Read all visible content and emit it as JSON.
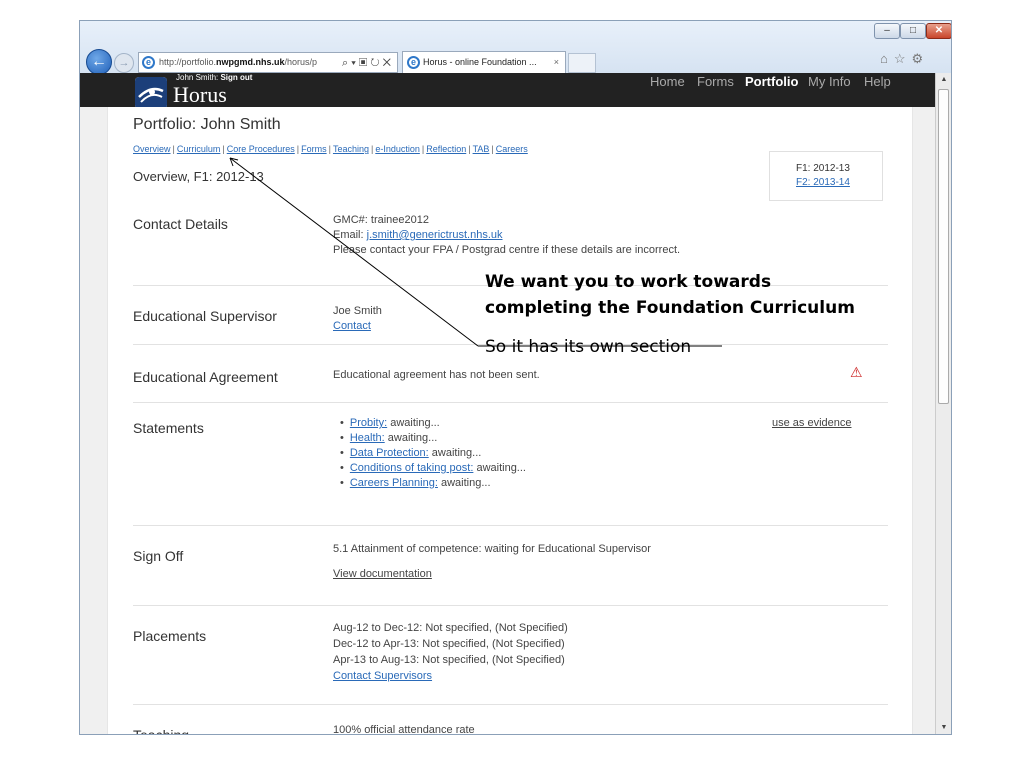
{
  "browser": {
    "address": "http://portfolio.",
    "address_domain": "nwpgmd.nhs.uk",
    "address_rest": "/horus/p",
    "address_controls": "⌕ ▾ ▣ ↻ ✕",
    "tab_title": "Horus - online Foundation ...",
    "tab_close": "×",
    "window_min": "–",
    "window_max": "□",
    "window_close": "✕",
    "back": "←",
    "forward": "→",
    "right_icons": "⌂☆⚙"
  },
  "header": {
    "user": "John Smith: ",
    "signout": "Sign out",
    "brand": "Horus",
    "nav": [
      "Home",
      "Forms",
      "Portfolio",
      "My Info",
      "Help"
    ]
  },
  "portfolio": {
    "title": "Portfolio: John Smith",
    "subnav": [
      "Overview",
      "Curriculum",
      "Core Procedures",
      "Forms",
      "Teaching",
      "e-Induction",
      "Reflection",
      "TAB",
      "Careers"
    ],
    "overview_label": "Overview, F1: 2012-13",
    "years": {
      "current": "F1: 2012-13",
      "next": "F2: 2013-14"
    }
  },
  "sections": {
    "contact": {
      "label": "Contact Details",
      "gmc": "GMC#: trainee2012",
      "email_prefix": "Email: ",
      "email": "j.smith@generictrust.nhs.uk",
      "note": "Please contact your FPA / Postgrad centre if these details are incorrect."
    },
    "supervisor": {
      "label": "Educational Supervisor",
      "name": "Joe Smith",
      "contact": "Contact"
    },
    "agreement": {
      "label": "Educational Agreement",
      "text": "Educational agreement has not been sent.",
      "warning": "⚠"
    },
    "statements": {
      "label": "Statements",
      "use_evidence": "use as evidence",
      "items": [
        {
          "name": "Probity:",
          "status": " awaiting..."
        },
        {
          "name": "Health:",
          "status": " awaiting..."
        },
        {
          "name": "Data Protection:",
          "status": " awaiting..."
        },
        {
          "name": "Conditions of taking post:",
          "status": " awaiting..."
        },
        {
          "name": "Careers Planning:",
          "status": " awaiting..."
        }
      ]
    },
    "signoff": {
      "label": "Sign Off",
      "text": "5.1 Attainment of competence: waiting for Educational Supervisor",
      "link": "View documentation"
    },
    "placements": {
      "label": "Placements",
      "rows": [
        "Aug-12 to Dec-12: Not specified, (Not Specified)",
        "Dec-12 to Apr-13: Not specified, (Not Specified)",
        "Apr-13 to Aug-13: Not specified, (Not Specified)"
      ],
      "link": "Contact Supervisors"
    },
    "teaching": {
      "label": "Teaching",
      "text": "100%  official attendance rate"
    }
  },
  "annotation": {
    "line1": "We want you to work towards",
    "line2": "completing the Foundation Curriculum",
    "line3": "So it has its own section"
  },
  "colors": {
    "accent_link": "#2a6ab8",
    "header_bg": "#222222",
    "warning": "#cc2222"
  }
}
